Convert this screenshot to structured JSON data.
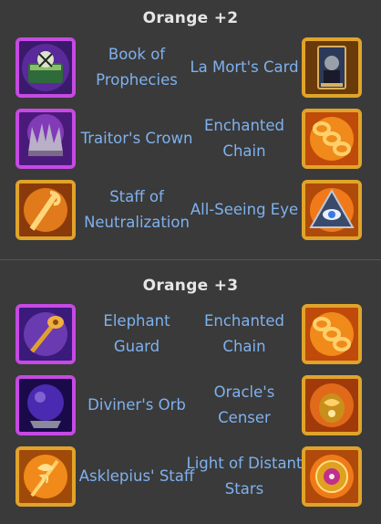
{
  "sections": [
    {
      "title": "Orange +2",
      "rows": [
        {
          "left": {
            "name": "Book of Prophecies",
            "icon": "book-of-prophecies-icon",
            "frame": "purple"
          },
          "right": {
            "name": "La Mort's Card",
            "icon": "la-morts-card-icon",
            "frame": "gold"
          }
        },
        {
          "left": {
            "name": "Traitor's Crown",
            "icon": "traitors-crown-icon",
            "frame": "purple"
          },
          "right": {
            "name": "Enchanted Chain",
            "icon": "enchanted-chain-icon",
            "frame": "gold"
          }
        },
        {
          "left": {
            "name": "Staff of Neutralization",
            "icon": "staff-of-neutralization-icon",
            "frame": "gold"
          },
          "right": {
            "name": "All-Seeing Eye",
            "icon": "all-seeing-eye-icon",
            "frame": "gold"
          }
        }
      ]
    },
    {
      "title": "Orange +3",
      "rows": [
        {
          "left": {
            "name": "Elephant Guard",
            "icon": "elephant-guard-icon",
            "frame": "purple"
          },
          "right": {
            "name": "Enchanted Chain",
            "icon": "enchanted-chain-icon",
            "frame": "gold"
          }
        },
        {
          "left": {
            "name": "Diviner's Orb",
            "icon": "diviners-orb-icon",
            "frame": "purple"
          },
          "right": {
            "name": "Oracle's Censer",
            "icon": "oracles-censer-icon",
            "frame": "gold"
          }
        },
        {
          "left": {
            "name": "Asklepius' Staff",
            "icon": "asklepius-staff-icon",
            "frame": "gold"
          },
          "right": {
            "name": "Light of Distant Stars",
            "icon": "light-of-distant-stars-icon",
            "frame": "gold"
          }
        }
      ]
    }
  ],
  "colors": {
    "background": "#3a3a3a",
    "title": "#e6e6e6",
    "item_text": "#7fb1ee",
    "frame_purple": "#c54ae2",
    "frame_gold": "#e0a42a"
  }
}
